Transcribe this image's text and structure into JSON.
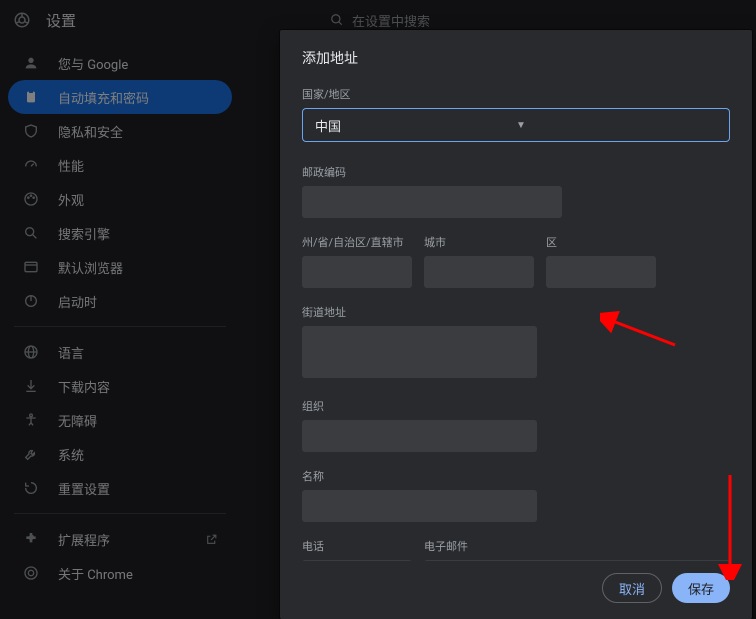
{
  "header": {
    "title": "设置",
    "search_placeholder": "在设置中搜索"
  },
  "sidebar": {
    "items": [
      {
        "icon": "person",
        "label": "您与 Google"
      },
      {
        "icon": "clipboard",
        "label": "自动填充和密码"
      },
      {
        "icon": "shield",
        "label": "隐私和安全"
      },
      {
        "icon": "speed",
        "label": "性能"
      },
      {
        "icon": "palette",
        "label": "外观"
      },
      {
        "icon": "search",
        "label": "搜索引擎"
      },
      {
        "icon": "browser",
        "label": "默认浏览器"
      },
      {
        "icon": "power",
        "label": "启动时"
      }
    ],
    "items2": [
      {
        "icon": "globe",
        "label": "语言"
      },
      {
        "icon": "download",
        "label": "下载内容"
      },
      {
        "icon": "a11y",
        "label": "无障碍"
      },
      {
        "icon": "wrench",
        "label": "系统"
      },
      {
        "icon": "reset",
        "label": "重置设置"
      }
    ],
    "items3": [
      {
        "icon": "puzzle",
        "label": "扩展程序",
        "ext": true
      },
      {
        "icon": "chrome",
        "label": "关于 Chrome"
      }
    ]
  },
  "dialog": {
    "title": "添加地址",
    "country_label": "国家/地区",
    "country_value": "中国",
    "postal_label": "邮政编码",
    "region_label": "州/省/自治区/直辖市",
    "city_label": "城市",
    "district_label": "区",
    "street_label": "街道地址",
    "org_label": "组织",
    "name_label": "名称",
    "phone_label": "电话",
    "email_label": "电子邮件",
    "cancel": "取消",
    "save": "保存"
  }
}
